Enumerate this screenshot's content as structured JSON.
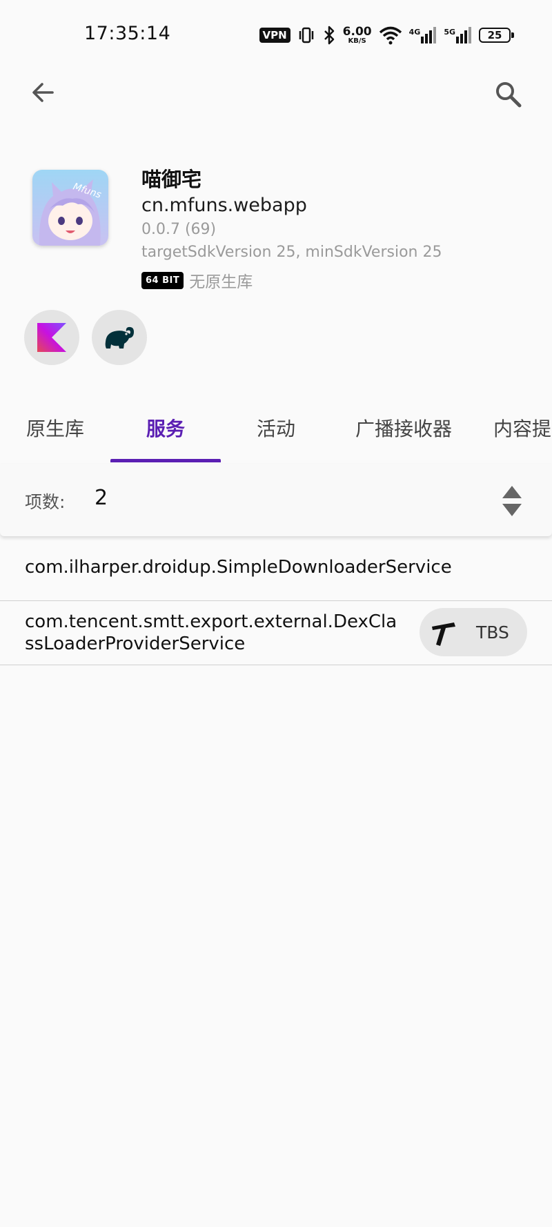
{
  "status_bar": {
    "time": "17:35:14",
    "vpn": "VPN",
    "speed_value": "6.00",
    "speed_unit": "KB/S",
    "network_1": "4G",
    "network_2": "5G",
    "battery": "25"
  },
  "app": {
    "name": "喵御宅",
    "package": "cn.mfuns.webapp",
    "version": "0.0.7 (69)",
    "sdk": "targetSdkVersion 25, minSdkVersion 25",
    "bit_badge": "64 BIT",
    "native_label": "无原生库",
    "icon_text": "Mfuns"
  },
  "tabs": [
    {
      "label": "原生库",
      "active": false
    },
    {
      "label": "服务",
      "active": true
    },
    {
      "label": "活动",
      "active": false
    },
    {
      "label": "广播接收器",
      "active": false
    },
    {
      "label": "内容提",
      "active": false
    }
  ],
  "count": {
    "label": "项数:",
    "value": "2"
  },
  "services": [
    {
      "name": "com.ilharper.droidup.SimpleDownloaderService"
    },
    {
      "name": "com.tencent.smtt.export.external.DexClassLoaderProviderService",
      "lib": "TBS"
    }
  ],
  "colors": {
    "accent": "#5b1fb3",
    "kotlin": "#7f52ff",
    "gradle": "#02303a"
  }
}
